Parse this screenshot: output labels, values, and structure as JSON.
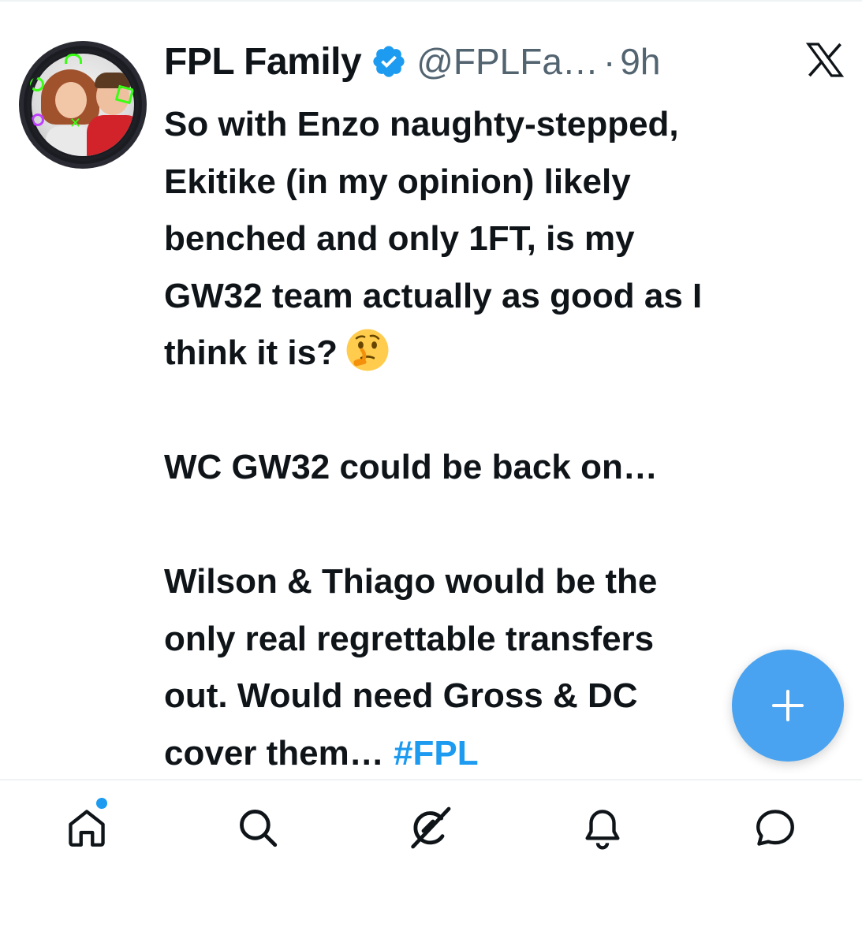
{
  "tweet": {
    "author_name": "FPL Family",
    "handle": "@FPLFa…",
    "separator": "·",
    "time": "9h",
    "verified": true,
    "avatar": "profile-photo",
    "lines": [
      "So with Enzo naughty-stepped,",
      "Ekitike (in my opinion) likely",
      "benched and only 1FT, is my",
      "GW32 team actually as good as I",
      "think it is?",
      "",
      "WC GW32 could be back on…",
      "",
      "Wilson & Thiago would be the",
      "only real regrettable transfers",
      "out. Would need Gross & DC",
      "cover them…"
    ],
    "emoji": "thinking-face",
    "hashtag": "#FPL"
  },
  "fab": {
    "icon": "plus-icon",
    "color": "#4aa3f0"
  },
  "bottom_nav": {
    "items": [
      {
        "name": "home",
        "icon": "home-icon",
        "has_notification_dot": true
      },
      {
        "name": "search",
        "icon": "search-icon"
      },
      {
        "name": "grok",
        "icon": "grok-icon"
      },
      {
        "name": "notifications",
        "icon": "bell-icon"
      },
      {
        "name": "messages",
        "icon": "message-icon"
      }
    ]
  },
  "colors": {
    "accent": "#1d9bf0",
    "text": "#0f1419",
    "secondary": "#536471"
  }
}
